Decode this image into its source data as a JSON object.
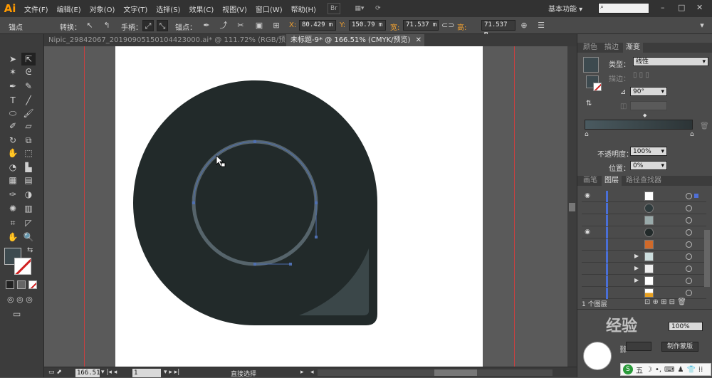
{
  "app": {
    "logo": "Ai",
    "menus": [
      "文件(F)",
      "编辑(E)",
      "对象(O)",
      "文字(T)",
      "选择(S)",
      "效果(C)",
      "视图(V)",
      "窗口(W)",
      "帮助(H)"
    ],
    "bridge_icon": "Br",
    "workspace": "基本功能",
    "search_placeholder": "",
    "window_buttons": [
      "–",
      "□",
      "✕"
    ]
  },
  "control_bar": {
    "mode_label": "锚点",
    "convert_label": "转换：",
    "handles_label": "手柄：",
    "anchor_label": "锚点：",
    "x_label": "X:",
    "x_value": "80.429 m",
    "y_label": "Y:",
    "y_value": "150.79 m",
    "w_label": "宽:",
    "w_value": "71.537 m",
    "h_label": "高:",
    "h_value": "71.537 m"
  },
  "doc_tabs": [
    {
      "label": "Nipic_29842067_20190905150104423000.ai* @ 111.72% (RGB/预览)",
      "close": "✕"
    },
    {
      "label": "未标题-9* @ 166.51% (CMYK/预览)",
      "close": "✕"
    }
  ],
  "status_bar": {
    "zoom": "166.51",
    "page": "1",
    "tool_name": "直接选择"
  },
  "panels": {
    "color_tabs": [
      "颜色",
      "描边",
      "渐变"
    ],
    "gradient_type_label": "类型：",
    "gradient_type_value": "线性",
    "stroke_label": "描边：",
    "angle_value": "90°",
    "opacity_label": "不透明度：",
    "opacity_value": "100%",
    "location_label": "位置：",
    "location_value": "0%",
    "layers_tabs": [
      "画笔",
      "图层",
      "路径查找器"
    ],
    "layer_count": "1 个图层",
    "bottom_opacity": "100%",
    "make_mask": "制作蒙版"
  },
  "colors": {
    "shape_fill": "#222a2a",
    "path_blue": "#4f6fb0",
    "ring": "#56646b",
    "corner_highlight": "#3b4749",
    "ui_dark": "#323232"
  },
  "icons": {
    "bottom_ime": "五",
    "watermark": "经验"
  }
}
